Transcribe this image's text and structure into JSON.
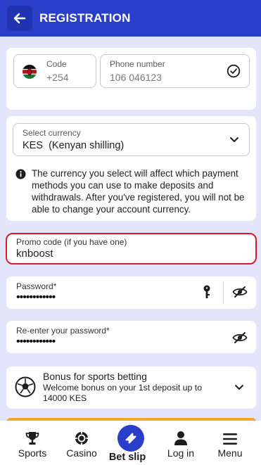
{
  "header": {
    "title": "REGISTRATION"
  },
  "phone": {
    "code_label": "Code",
    "code_value": "+254",
    "number_label": "Phone number",
    "number_value": "106 046123"
  },
  "currency": {
    "label": "Select currency",
    "value": "KES  (Kenyan shilling)",
    "info": "The currency you select will affect which payment methods you can use to make deposits and withdrawals. After you've registered, you will not be able to change your account currency."
  },
  "promo": {
    "label": "Promo code (if you have one)",
    "value": "knboost"
  },
  "password": {
    "label": "Password*",
    "value": "••••••••••••"
  },
  "password_confirm": {
    "label": "Re-enter your password*",
    "value": "••••••••••••"
  },
  "bonus": {
    "title": "Bonus for sports betting",
    "description": "Welcome bonus on your 1st deposit up to 14000 KES"
  },
  "nav": {
    "sports": "Sports",
    "casino": "Casino",
    "betslip": "Bet slip",
    "login": "Log in",
    "menu": "Menu"
  },
  "colors": {
    "brand": "#2a3fc9",
    "promo_border": "#d9192b",
    "background": "#e3e6fb",
    "accent_orange": "#f5a623"
  }
}
